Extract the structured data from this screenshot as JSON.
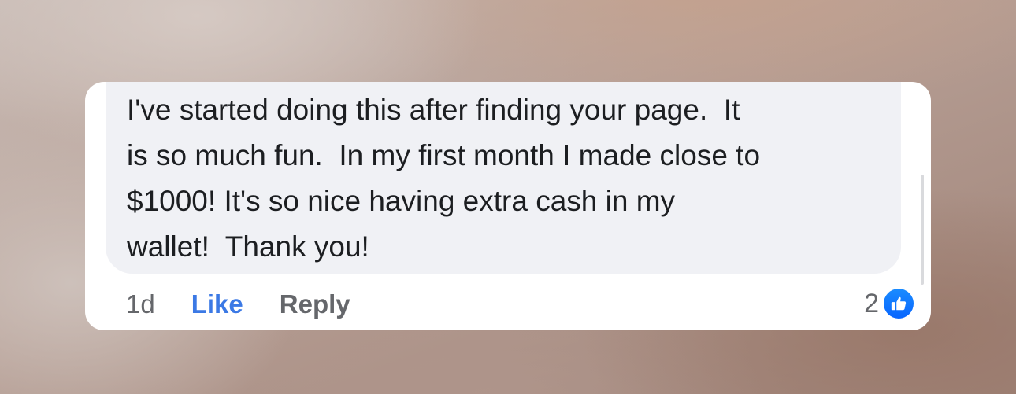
{
  "comment": {
    "lines": [
      "I've started doing this after finding your page.  It",
      "is so much fun.  In my first month I made close to",
      "$1000! It's so nice having extra cash in my",
      "wallet!  Thank you!"
    ]
  },
  "actions": {
    "time": "1d",
    "like_label": "Like",
    "reply_label": "Reply"
  },
  "reactions": {
    "count": "2",
    "icon": "thumbs-up-icon",
    "color": "#1877f2"
  },
  "colors": {
    "like_link": "#3b79e5",
    "bubble": "#f0f1f5",
    "meta_text": "#65676b"
  }
}
